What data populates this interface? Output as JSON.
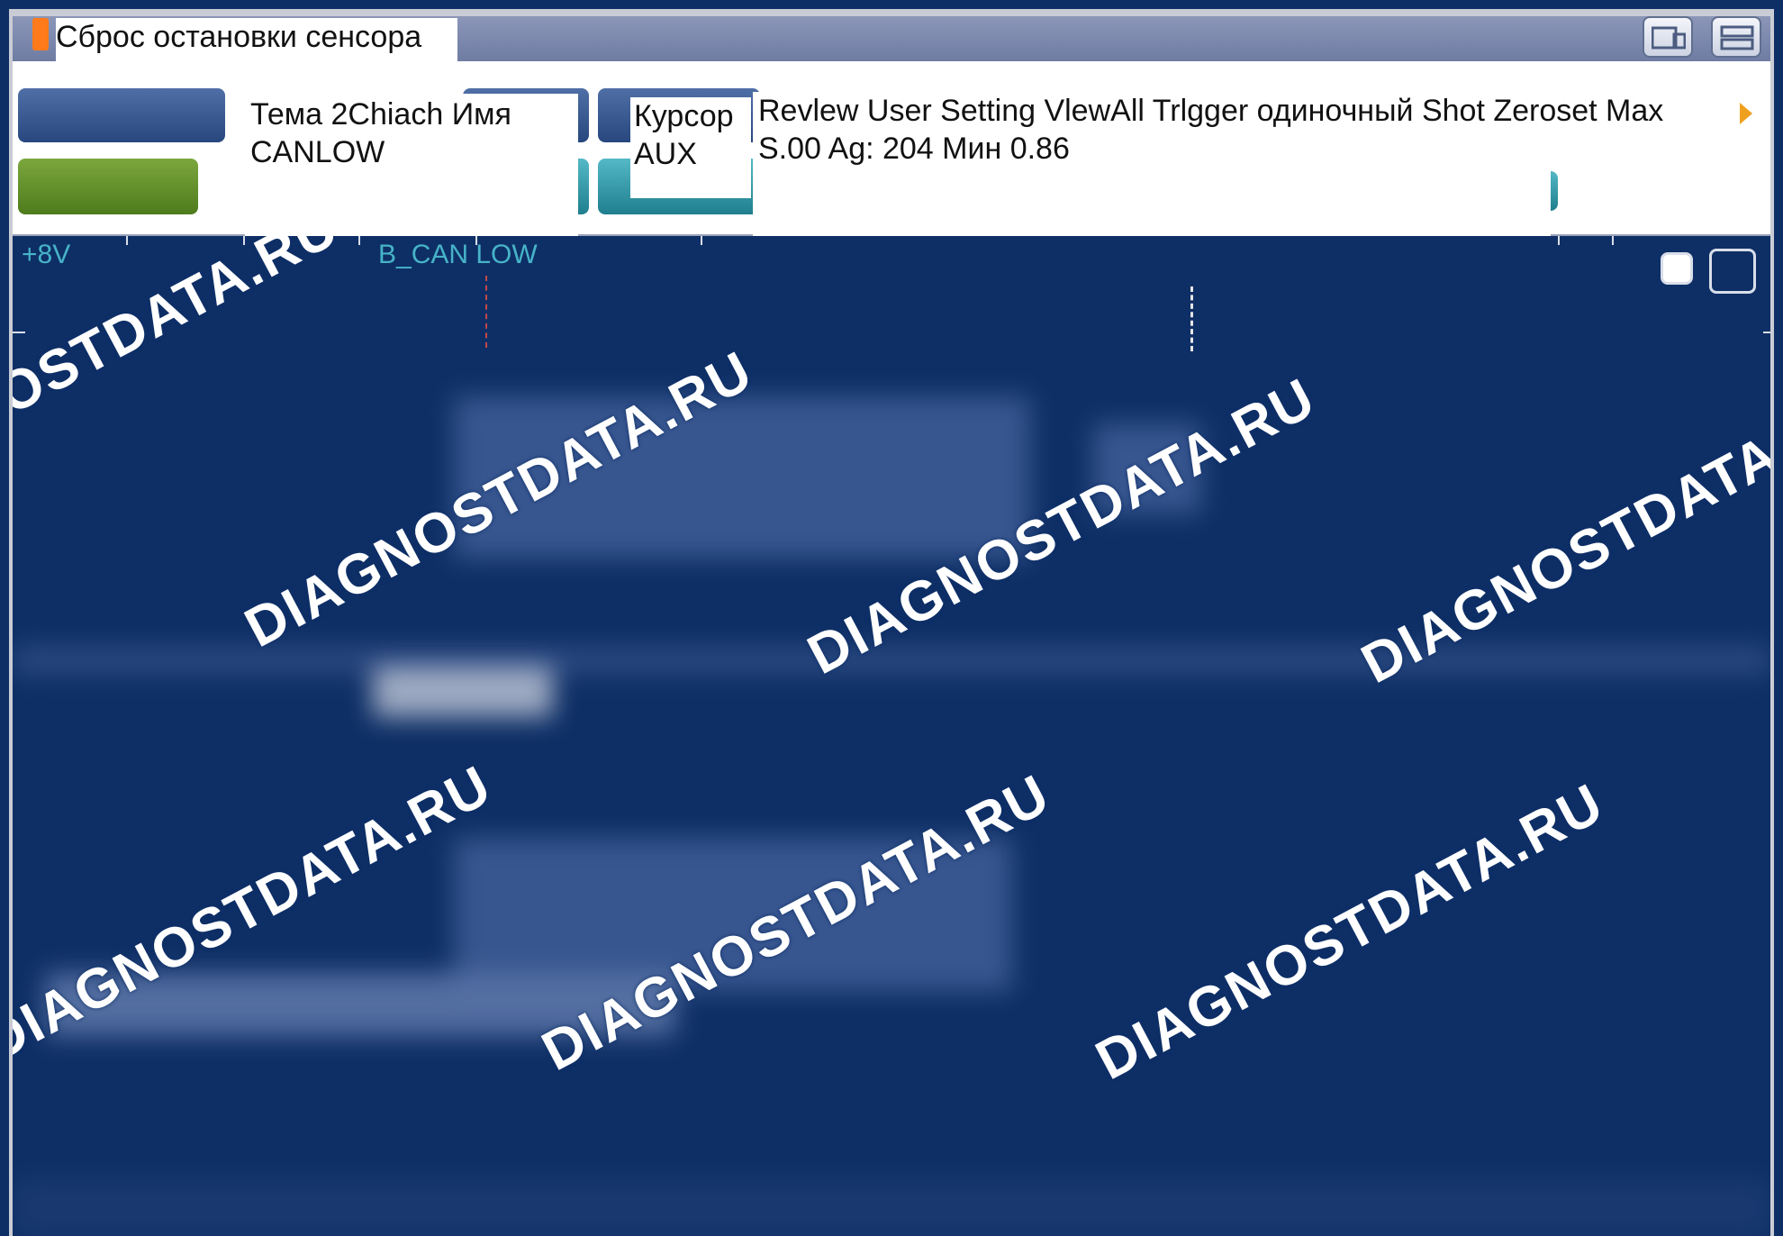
{
  "window": {
    "title": "Сброс остановки сенсора осциллографа"
  },
  "theme_popup": {
    "line1": "Тема 2Chiach Имя",
    "line2": "CANLOW"
  },
  "cursor_popup": {
    "line1": "Курсор",
    "line2": "AUX"
  },
  "view_popup": {
    "line1": "Revlew User Setting VlewAll Trlgger одиночный Shot Zeroset Max",
    "line2": "S.00 Ag: 204 Мин 0.86"
  },
  "scope": {
    "voltage_label": "+8V",
    "channel_label": "B_CAN LOW"
  },
  "watermark": "DIAGNOSTDATA.RU",
  "colors": {
    "background": "#0e2f66",
    "accent_orange": "#ff7a1a",
    "channel_label": "#47b3c8"
  }
}
